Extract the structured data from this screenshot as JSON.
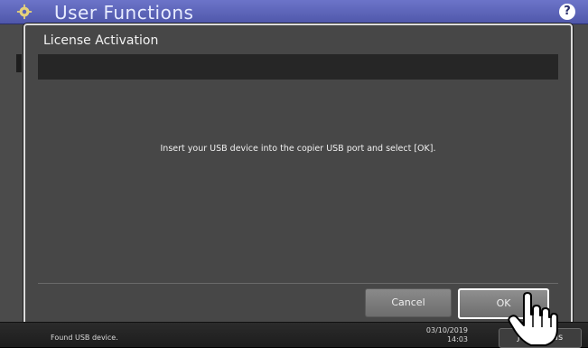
{
  "header": {
    "title": "User Functions",
    "help_icon": "help-icon",
    "gear_icon": "gear-icon"
  },
  "dialog": {
    "title": "License Activation",
    "message": "Insert your USB device into the copier USB port and select [OK].",
    "cancel_label": "Cancel",
    "ok_label": "OK"
  },
  "footer": {
    "status": "Found USB device.",
    "date": "03/10/2019",
    "time": "14:03",
    "job_status_label": "Job Status"
  },
  "colors": {
    "title_bar": "#5b63b8",
    "dialog_bg": "#474747",
    "ok_border": "#ffffff"
  }
}
